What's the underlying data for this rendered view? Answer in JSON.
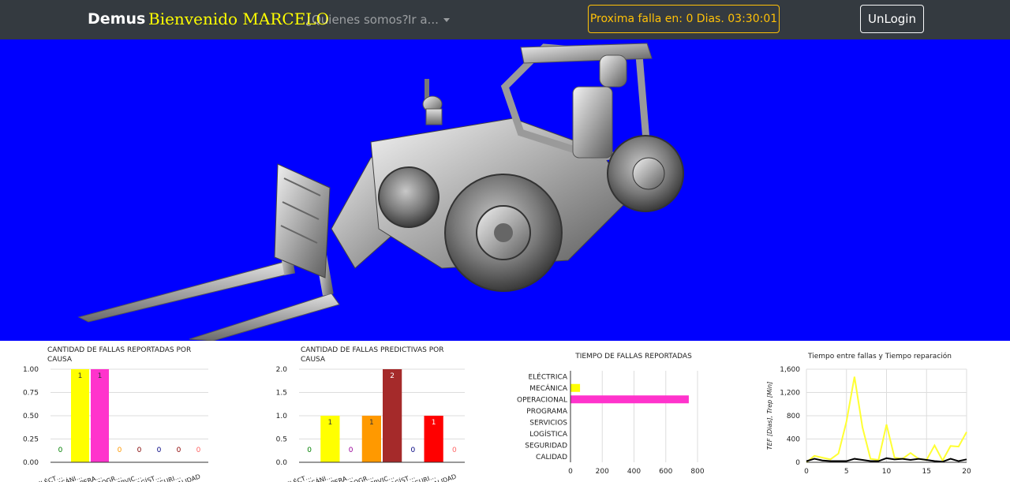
{
  "navbar": {
    "brand": "Demus",
    "welcome": "Bienvenido MARCELO",
    "about_link": "¿Quienes somos?",
    "goto_link": "Ir a...",
    "next_fault": "Proxima falla en: 0 Dias. 03:30:01",
    "logout_label": "UnLogin"
  },
  "viewer": {
    "background": "#0000ff",
    "model": "forklift-3d-model"
  },
  "chart_data": [
    {
      "type": "bar",
      "title": "CANTIDAD DE FALLAS REPORTADAS POR CAUSA",
      "title_lines": [
        "CANTIDAD DE FALLAS REPORTADAS POR",
        "CAUSA"
      ],
      "categories": [
        "ELÉCT…",
        "MECÁNI…",
        "OPERA…",
        "PROGR…",
        "SERVIC…",
        "LOGÍST…",
        "SEGURI…",
        "CALIDAD"
      ],
      "values": [
        0,
        1,
        1,
        0,
        0,
        0,
        0,
        0
      ],
      "colors": [
        "#008000",
        "#ffff00",
        "#ff33cc",
        "#ff9900",
        "#800000",
        "#000080",
        "#8b0000",
        "#ff6666"
      ],
      "ylim": [
        0,
        1
      ],
      "yticks": [
        "0.00",
        "0.25",
        "0.50",
        "0.75",
        "1.00"
      ]
    },
    {
      "type": "bar",
      "title": "CANTIDAD DE FALLAS PREDICTIVAS POR CAUSA",
      "title_lines": [
        "CANTIDAD DE FALLAS PREDICTIVAS POR",
        "CAUSA"
      ],
      "categories": [
        "ELÉCT…",
        "MECÁNI…",
        "OPERA…",
        "PROGR…",
        "SERVIC…",
        "LOGÍST…",
        "SEGURI…",
        "CALIDAD"
      ],
      "values": [
        0,
        1,
        0,
        1,
        2,
        0,
        1,
        0
      ],
      "colors": [
        "#008000",
        "#ffff00",
        "#990099",
        "#ff9900",
        "#a52a2a",
        "#000080",
        "#ff0000",
        "#ff6666"
      ],
      "ylim": [
        0,
        2
      ],
      "yticks": [
        "0.0",
        "0.5",
        "1.0",
        "1.5",
        "2.0"
      ]
    },
    {
      "type": "bar",
      "orientation": "horizontal",
      "title": "TIEMPO DE FALLAS REPORTADAS",
      "categories": [
        "ELÉCTRICA",
        "MECÁNICA",
        "OPERACIONAL",
        "PROGRAMA",
        "SERVICIOS",
        "LOGÍSTICA",
        "SEGURIDAD",
        "CALIDAD"
      ],
      "values": [
        0,
        60,
        745,
        0,
        0,
        0,
        0,
        0
      ],
      "colors": [
        "#008000",
        "#ffff00",
        "#ff33cc",
        "#ff9900",
        "#800000",
        "#000080",
        "#8b0000",
        "#ff6666"
      ],
      "xlim": [
        0,
        800
      ],
      "xticks": [
        "0",
        "200",
        "400",
        "600",
        "800"
      ]
    },
    {
      "type": "line",
      "title": "Tiempo entre fallas y Tiempo reparación",
      "ylabel": "TEF [Dias], Trep [Min]",
      "xlim": [
        0,
        20
      ],
      "ylim": [
        0,
        1600
      ],
      "xticks": [
        "0",
        "5",
        "10",
        "15",
        "20"
      ],
      "yticks": [
        "0",
        "400",
        "800",
        "1,200",
        "1,600"
      ],
      "x": [
        0,
        1,
        2,
        3,
        4,
        5,
        6,
        7,
        8,
        9,
        10,
        11,
        12,
        13,
        14,
        15,
        16,
        17,
        18,
        19,
        20
      ],
      "series": [
        {
          "color": "#ffff33",
          "values": [
            0,
            110,
            80,
            50,
            150,
            700,
            1470,
            600,
            60,
            40,
            650,
            80,
            60,
            160,
            60,
            40,
            290,
            30,
            280,
            270,
            520
          ]
        },
        {
          "color": "#000000",
          "values": [
            20,
            60,
            30,
            20,
            20,
            20,
            60,
            40,
            20,
            20,
            70,
            50,
            60,
            40,
            60,
            40,
            20,
            10,
            60,
            20,
            50
          ]
        }
      ]
    }
  ]
}
